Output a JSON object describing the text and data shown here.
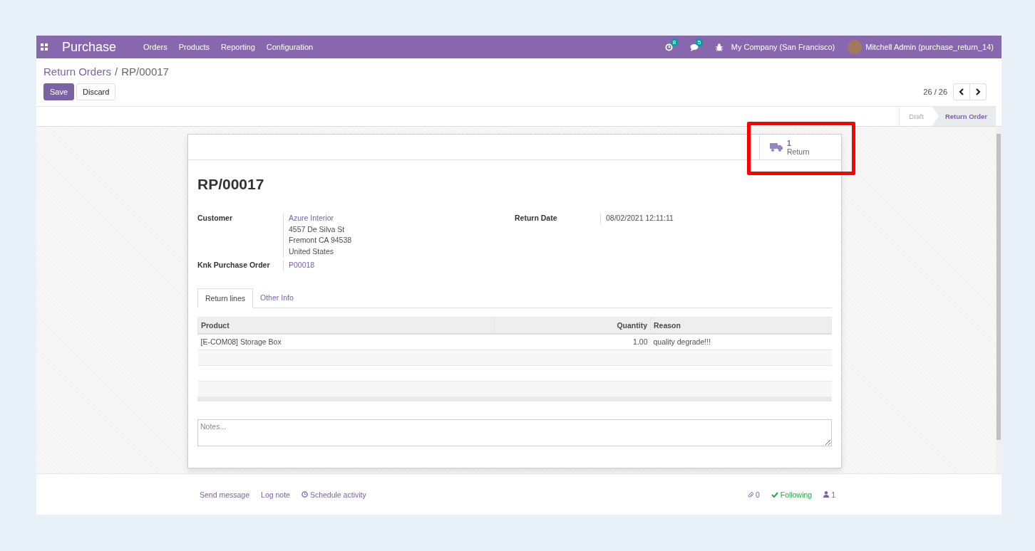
{
  "navbar": {
    "app_name": "Purchase",
    "menu": [
      "Orders",
      "Products",
      "Reporting",
      "Configuration"
    ],
    "activity_count": "8",
    "message_count": "5",
    "company": "My Company (San Francisco)",
    "user": "Mitchell Admin (purchase_return_14)"
  },
  "breadcrumb": {
    "parent": "Return Orders",
    "separator": "/",
    "current": "RP/00017"
  },
  "buttons": [
    {
      "label": "Save",
      "kind": "primary"
    },
    {
      "label": "Discard",
      "kind": "secondary"
    }
  ],
  "pager": "26 / 26",
  "statusbar": [
    {
      "label": "Draft",
      "selected": false
    },
    {
      "label": "Return Order",
      "selected": true
    }
  ],
  "smart_button": {
    "count": "1",
    "label": "Return",
    "highlighted": true
  },
  "record": {
    "name": "RP/00017",
    "fields_left": [
      {
        "label": "Customer",
        "kind": "address",
        "value": "Azure Interior",
        "lines": [
          "4557 De Silva St",
          "Fremont CA 94538",
          "United States"
        ]
      },
      {
        "label": "Knk Purchase Order",
        "kind": "link",
        "value": "P00018"
      }
    ],
    "fields_right": [
      {
        "label": "Return Date",
        "kind": "text",
        "value": "08/02/2021 12:11:11"
      }
    ]
  },
  "tabs": [
    {
      "label": "Return lines",
      "selected": true
    },
    {
      "label": "Other Info",
      "selected": false
    }
  ],
  "table": {
    "columns": [
      {
        "label": "Product",
        "kind": "text"
      },
      {
        "label": "Quantity",
        "kind": "number"
      },
      {
        "label": "Reason",
        "kind": "text"
      }
    ],
    "rows": [
      [
        "[E-COM08] Storage Box",
        "1.00",
        "quality degrade!!!"
      ]
    ]
  },
  "notes": {
    "placeholder": "Notes..."
  },
  "chatter": {
    "actions": [
      {
        "label": "Send message",
        "kind": "plain"
      },
      {
        "label": "Log note",
        "kind": "plain"
      },
      {
        "label": "Schedule activity",
        "kind": "clock"
      }
    ],
    "attachments": "0",
    "following": "Following",
    "followers": "1"
  }
}
